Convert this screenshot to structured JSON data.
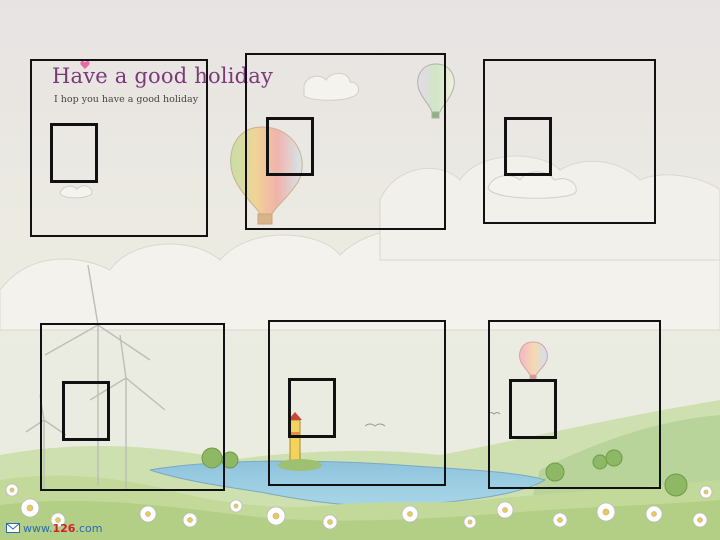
{
  "header": {
    "title": "Have a good holiday",
    "subtitle": "I hop you have a good holiday"
  },
  "watermark": {
    "prefix": "www.",
    "number": "126",
    "suffix": ".com"
  },
  "colors": {
    "title": "#7a3a78",
    "heart": "#e86aa6",
    "frame": "#111111",
    "sky": "#e9e6dc",
    "water": "#7fb6d3",
    "grass": "#a9c67a"
  },
  "frames_count": 6
}
